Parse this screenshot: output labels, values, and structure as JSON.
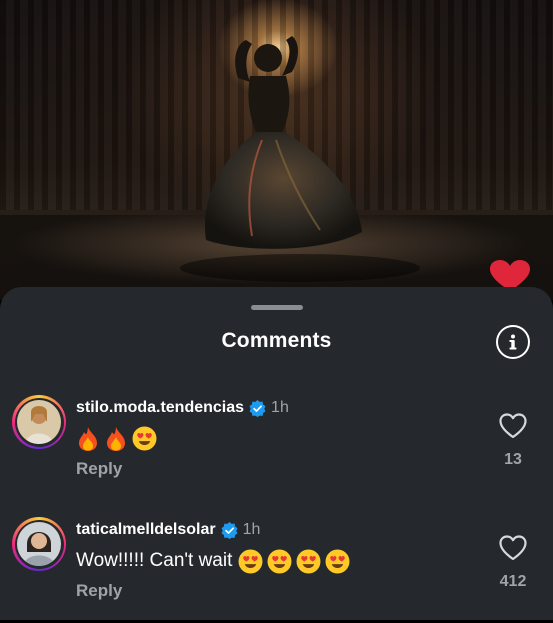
{
  "sheet": {
    "title": "Comments"
  },
  "comments": [
    {
      "username": "stilo.moda.tendencias",
      "verified": true,
      "time": "1h",
      "text": "",
      "emojis": [
        "fire",
        "fire",
        "heart-eyes"
      ],
      "reply_label": "Reply",
      "like_count": "13"
    },
    {
      "username": "taticalmelldelsolar",
      "verified": true,
      "time": "1h",
      "text": "Wow!!!!! Can't wait",
      "emojis": [
        "heart-eyes",
        "heart-eyes",
        "heart-eyes",
        "heart-eyes"
      ],
      "reply_label": "Reply",
      "like_count": "412"
    }
  ],
  "colors": {
    "sheet_bg": "#25292e",
    "muted_text": "#a0a4a9",
    "verified_blue": "#1d9bf0",
    "like_red": "#e0263a"
  },
  "icons": {
    "info": "info-circle-icon",
    "like": "heart-outline-icon",
    "floating_like": "heart-filled-icon",
    "verified": "verified-badge-icon"
  }
}
